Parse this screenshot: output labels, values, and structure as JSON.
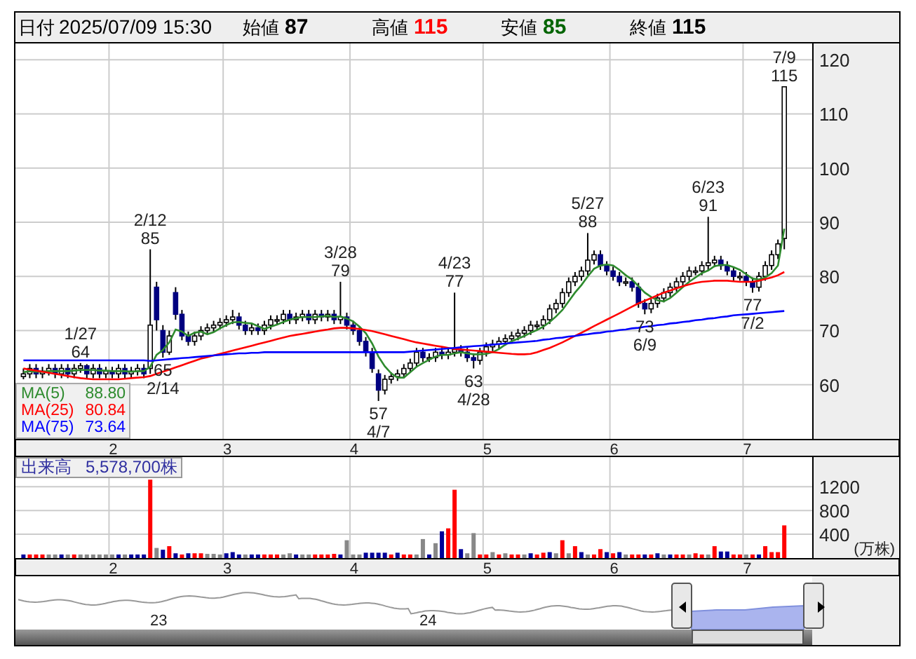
{
  "header": {
    "date_label": "日付",
    "date": "2025/07/09 15:30",
    "fields": [
      {
        "label": "始値",
        "value": "87",
        "color": "#000000"
      },
      {
        "label": "高値",
        "value": "115",
        "color": "#ff0000"
      },
      {
        "label": "安値",
        "value": "85",
        "color": "#006400"
      },
      {
        "label": "終値",
        "value": "115",
        "color": "#000000"
      }
    ]
  },
  "price": {
    "chart_data": {
      "type": "candlestick",
      "ylim": [
        50,
        123
      ],
      "yticks": [
        60,
        70,
        80,
        90,
        100,
        110,
        120
      ],
      "categories": [
        null,
        null,
        null,
        null,
        null,
        null,
        null,
        null,
        null,
        null,
        null,
        null,
        null,
        null,
        "2",
        null,
        null,
        null,
        null,
        null,
        null,
        null,
        null,
        null,
        null,
        null,
        null,
        null,
        null,
        null,
        null,
        null,
        "3",
        null,
        null,
        null,
        null,
        null,
        null,
        null,
        null,
        null,
        null,
        null,
        null,
        null,
        null,
        null,
        null,
        null,
        null,
        null,
        "4",
        null,
        null,
        null,
        null,
        null,
        null,
        null,
        null,
        null,
        null,
        null,
        null,
        null,
        null,
        null,
        null,
        null,
        null,
        null,
        null,
        "5",
        null,
        null,
        null,
        null,
        null,
        null,
        null,
        null,
        null,
        null,
        null,
        null,
        null,
        null,
        null,
        null,
        null,
        null,
        null,
        "6",
        null,
        null,
        null,
        null,
        null,
        null,
        null,
        null,
        null,
        null,
        null,
        null,
        null,
        null,
        null,
        null,
        null,
        null,
        null,
        null,
        "7",
        null,
        null,
        null,
        null,
        null,
        null
      ],
      "grid": true,
      "ohlc": [
        [
          61.5,
          63,
          61,
          62
        ],
        [
          62,
          63.8,
          61.2,
          63
        ],
        [
          63,
          63.8,
          61.2,
          62
        ],
        [
          62,
          63.3,
          61.2,
          62.5
        ],
        [
          62.5,
          63.8,
          61.7,
          63
        ],
        [
          63,
          63.8,
          61.2,
          62
        ],
        [
          62,
          63.8,
          61.2,
          63
        ],
        [
          63,
          63.8,
          61.2,
          62
        ],
        [
          62,
          63.8,
          61.2,
          63
        ],
        [
          63,
          64,
          62.2,
          63.5
        ],
        [
          63.5,
          63.8,
          61.2,
          62
        ],
        [
          62,
          63.8,
          61.2,
          63
        ],
        [
          63,
          63.8,
          61.2,
          62
        ],
        [
          62,
          63.3,
          61.2,
          62.5
        ],
        [
          62.5,
          63.3,
          61.2,
          62
        ],
        [
          62,
          63.8,
          61.2,
          63
        ],
        [
          63,
          63.8,
          61.2,
          62
        ],
        [
          62,
          63.3,
          61.2,
          62.5
        ],
        [
          62.5,
          63.8,
          61.7,
          63
        ],
        [
          63,
          63.8,
          61.2,
          62
        ],
        [
          63,
          85,
          62,
          71
        ],
        [
          78,
          79,
          70,
          72
        ],
        [
          70,
          71,
          65,
          66
        ],
        [
          66,
          70,
          65.5,
          69
        ],
        [
          77,
          78,
          72,
          73
        ],
        [
          73,
          73.8,
          68.2,
          69
        ],
        [
          69,
          69.8,
          67.2,
          68
        ],
        [
          68,
          69.8,
          67.2,
          69
        ],
        [
          69,
          70.8,
          68.2,
          70
        ],
        [
          70,
          71.3,
          69.2,
          70.5
        ],
        [
          70.5,
          71.8,
          69.7,
          71
        ],
        [
          71,
          72.3,
          70.2,
          71.5
        ],
        [
          71.5,
          72.8,
          70.7,
          72
        ],
        [
          72,
          73.8,
          71.2,
          72.5
        ],
        [
          72.5,
          73.3,
          70.2,
          71
        ],
        [
          71,
          71.8,
          69.2,
          70
        ],
        [
          70,
          71.3,
          69.2,
          70.5
        ],
        [
          70.5,
          71.3,
          69.2,
          70
        ],
        [
          70,
          71.8,
          69.2,
          71
        ],
        [
          71,
          72.8,
          70.2,
          72
        ],
        [
          72,
          72.8,
          71.2,
          72
        ],
        [
          72,
          73.8,
          71.2,
          73
        ],
        [
          73,
          73.8,
          71.2,
          72
        ],
        [
          72,
          73.3,
          71.2,
          72.5
        ],
        [
          72.5,
          73.8,
          71.7,
          73
        ],
        [
          73,
          73.8,
          71.2,
          72
        ],
        [
          72,
          73.8,
          71.2,
          73
        ],
        [
          73,
          73.8,
          71.7,
          72.5
        ],
        [
          72.5,
          73.8,
          71.7,
          73
        ],
        [
          73,
          73.8,
          71.2,
          72
        ],
        [
          72,
          79,
          71.2,
          72.5
        ],
        [
          72.5,
          73.3,
          70.2,
          71
        ],
        [
          71,
          71.8,
          69.2,
          70
        ],
        [
          70,
          70.8,
          67.2,
          68
        ],
        [
          68,
          68.8,
          65.2,
          66
        ],
        [
          66,
          66.8,
          62.2,
          63
        ],
        [
          62,
          62.8,
          57,
          59
        ],
        [
          59,
          61.8,
          58.2,
          61
        ],
        [
          61,
          62.3,
          60.2,
          61.5
        ],
        [
          61.5,
          62.8,
          60.7,
          62
        ],
        [
          62,
          63.8,
          61.2,
          63
        ],
        [
          63,
          64.8,
          62.2,
          64
        ],
        [
          64,
          66.8,
          63.2,
          66
        ],
        [
          66,
          66.8,
          64.2,
          65
        ],
        [
          65,
          65.8,
          64.2,
          65
        ],
        [
          65,
          66.8,
          64.2,
          66
        ],
        [
          66,
          66.8,
          64.7,
          65.5
        ],
        [
          65.5,
          66.8,
          64.7,
          66
        ],
        [
          66,
          77,
          65.2,
          66.5
        ],
        [
          66.5,
          67.3,
          65.2,
          66
        ],
        [
          66,
          66.8,
          64.2,
          65
        ],
        [
          65,
          65.8,
          63,
          64.5
        ],
        [
          64.5,
          66.8,
          63.7,
          66
        ],
        [
          66,
          67.8,
          65.2,
          67
        ],
        [
          67,
          68.3,
          66.2,
          67.5
        ],
        [
          67.5,
          68.8,
          66.7,
          68
        ],
        [
          68,
          69.3,
          67.2,
          68.5
        ],
        [
          68.5,
          69.8,
          67.7,
          69
        ],
        [
          69,
          70.3,
          68.2,
          69.5
        ],
        [
          69.5,
          70.8,
          68.7,
          70
        ],
        [
          70,
          71.8,
          69.2,
          71
        ],
        [
          71,
          71.8,
          70.2,
          71
        ],
        [
          71,
          72.8,
          70.2,
          72
        ],
        [
          72,
          74.8,
          71.2,
          74
        ],
        [
          74,
          75.8,
          73.2,
          75
        ],
        [
          75,
          77.8,
          74.2,
          77
        ],
        [
          77,
          79.8,
          76.2,
          79
        ],
        [
          79,
          80.8,
          78.2,
          80
        ],
        [
          80,
          81.8,
          79.2,
          81
        ],
        [
          81,
          88,
          80.2,
          83
        ],
        [
          83,
          84.8,
          82.2,
          84
        ],
        [
          84,
          84.8,
          81.2,
          82
        ],
        [
          82,
          82.8,
          80.2,
          81
        ],
        [
          81,
          81.8,
          79.2,
          80
        ],
        [
          80,
          80.8,
          78.2,
          79
        ],
        [
          79,
          79.8,
          78.2,
          79
        ],
        [
          79,
          79.8,
          77.2,
          78
        ],
        [
          78,
          78.8,
          74.2,
          75
        ],
        [
          75,
          75.8,
          73,
          74
        ],
        [
          74,
          75.8,
          73.2,
          75
        ],
        [
          75,
          76.8,
          74.2,
          76
        ],
        [
          76,
          77.8,
          75.2,
          77
        ],
        [
          77,
          78.8,
          76.2,
          78
        ],
        [
          78,
          79.8,
          77.2,
          79
        ],
        [
          79,
          80.8,
          78.2,
          80
        ],
        [
          80,
          81.8,
          79.2,
          81
        ],
        [
          81,
          81.8,
          80.2,
          81
        ],
        [
          81,
          82.8,
          80.2,
          82
        ],
        [
          82,
          91,
          81.2,
          82.5
        ],
        [
          82.5,
          83.8,
          81.7,
          83
        ],
        [
          83,
          83.8,
          81.2,
          82
        ],
        [
          82,
          82.8,
          80.2,
          81
        ],
        [
          81,
          81.8,
          79.2,
          80
        ],
        [
          80,
          80.8,
          79.2,
          80
        ],
        [
          80,
          80.8,
          78.2,
          79
        ],
        [
          79,
          79.8,
          77,
          78
        ],
        [
          78,
          80.8,
          77.2,
          80
        ],
        [
          80,
          82.8,
          79.2,
          82
        ],
        [
          82,
          84.8,
          81.2,
          84
        ],
        [
          84,
          86.8,
          83.2,
          86
        ],
        [
          87,
          115,
          85,
          115
        ]
      ],
      "series": [
        {
          "name": "MA(5)",
          "type": "line",
          "color": "#2e8b2e",
          "values": [
            62.3,
            62.5,
            62.4,
            62.4,
            62.5,
            62.5,
            62.5,
            62.5,
            62.6,
            62.7,
            62.7,
            62.7,
            62.6,
            62.6,
            62.5,
            62.5,
            62.5,
            62.4,
            62.5,
            62.5,
            63.3,
            65.5,
            66.4,
            67.8,
            70.2,
            69.8,
            69,
            69.6,
            69.8,
            69.3,
            69.7,
            70.4,
            71,
            71.5,
            71.6,
            71.4,
            71.3,
            70.8,
            70.3,
            70.7,
            71.1,
            71.6,
            72,
            72.3,
            72.5,
            72.5,
            72.5,
            72.6,
            72.7,
            72.5,
            72.6,
            72.2,
            71.7,
            70.7,
            69.5,
            67.6,
            65.2,
            63.4,
            62.1,
            61.3,
            61.3,
            62.3,
            63.3,
            64,
            64.6,
            65.2,
            65.5,
            65.5,
            65.8,
            66,
            65.8,
            65.6,
            65.6,
            65.7,
            66,
            66.6,
            67.4,
            68,
            68.5,
            69,
            69.6,
            70.1,
            70.7,
            71.6,
            72.6,
            73.8,
            75.4,
            77,
            78.4,
            80,
            81.4,
            82,
            82.2,
            82,
            81.2,
            80.2,
            79.4,
            78.2,
            77,
            76.2,
            75.6,
            75.4,
            76,
            77,
            78,
            79,
            79.8,
            80.6,
            81.1,
            81.9,
            82.1,
            82.1,
            81.7,
            81.2,
            80.4,
            79.6,
            79.4,
            79.8,
            80.6,
            82,
            88.8
          ]
        },
        {
          "name": "MA(25)",
          "type": "line",
          "color": "#ff0000",
          "values": [
            63,
            62.8,
            62.6,
            62.4,
            62.2,
            62,
            61.8,
            61.6,
            61.4,
            61.2,
            61.1,
            61,
            61,
            61,
            61,
            61,
            61.1,
            61.2,
            61.3,
            61.4,
            61.6,
            62,
            62.4,
            62.8,
            63.2,
            63.6,
            64,
            64.4,
            64.8,
            65.1,
            65.4,
            65.7,
            66,
            66.3,
            66.6,
            66.9,
            67.2,
            67.5,
            67.8,
            68.1,
            68.4,
            68.7,
            69,
            69.2,
            69.4,
            69.6,
            69.8,
            70,
            70.2,
            70.4,
            70.5,
            70.5,
            70.4,
            70.3,
            70.1,
            69.9,
            69.6,
            69.3,
            69,
            68.7,
            68.4,
            68.1,
            67.8,
            67.6,
            67.4,
            67.2,
            67,
            66.8,
            66.6,
            66.5,
            66.4,
            66.3,
            66.2,
            66.1,
            66,
            65.9,
            65.8,
            65.7,
            65.6,
            65.6,
            65.7,
            66,
            66.4,
            66.8,
            67.3,
            67.8,
            68.4,
            69,
            69.6,
            70.2,
            70.8,
            71.4,
            72,
            72.6,
            73.2,
            73.8,
            74.4,
            75,
            75.5,
            76,
            76.5,
            77,
            77.4,
            77.8,
            78.2,
            78.5,
            78.8,
            79,
            79.1,
            79.2,
            79.2,
            79.2,
            79.1,
            79,
            79,
            79,
            79.2,
            79.5,
            79.8,
            80.2,
            80.8
          ]
        },
        {
          "name": "MA(75)",
          "type": "line",
          "color": "#0000ff",
          "values": [
            64.5,
            64.5,
            64.5,
            64.5,
            64.5,
            64.5,
            64.5,
            64.5,
            64.5,
            64.5,
            64.5,
            64.5,
            64.5,
            64.5,
            64.5,
            64.5,
            64.5,
            64.5,
            64.5,
            64.5,
            64.4,
            64.5,
            64.6,
            64.7,
            64.8,
            64.9,
            65,
            65.1,
            65.2,
            65.3,
            65.4,
            65.5,
            65.6,
            65.7,
            65.8,
            65.8,
            65.9,
            65.9,
            66,
            66,
            66,
            66,
            66,
            66,
            66,
            66,
            66,
            66,
            66,
            66,
            66,
            66,
            66,
            66,
            66,
            66,
            66,
            66,
            66,
            66,
            66,
            66.1,
            66.2,
            66.3,
            66.4,
            66.5,
            66.6,
            66.7,
            66.8,
            66.9,
            67,
            67.1,
            67.2,
            67.3,
            67.4,
            67.5,
            67.6,
            67.7,
            67.8,
            67.9,
            68,
            68.1,
            68.3,
            68.4,
            68.6,
            68.7,
            68.9,
            69,
            69.2,
            69.3,
            69.5,
            69.6,
            69.8,
            69.9,
            70.1,
            70.2,
            70.4,
            70.5,
            70.7,
            70.8,
            71,
            71.1,
            71.3,
            71.4,
            71.6,
            71.7,
            71.9,
            72,
            72.2,
            72.3,
            72.5,
            72.6,
            72.8,
            72.9,
            73,
            73.1,
            73.2,
            73.3,
            73.4,
            73.5,
            73.6
          ]
        }
      ],
      "annotations": [
        {
          "y": 64,
          "text": "1/27\n64"
        },
        {
          "y": 85,
          "text": "2/12\n85"
        },
        {
          "y": 65,
          "text": "65\n2/14"
        },
        {
          "y": 79,
          "text": "3/28\n79"
        },
        {
          "y": 57,
          "text": "57\n4/7"
        },
        {
          "y": 77,
          "text": "4/23\n77"
        },
        {
          "y": 63,
          "text": "63\n4/28"
        },
        {
          "y": 88,
          "text": "5/27\n88"
        },
        {
          "y": 73,
          "text": "73\n6/9"
        },
        {
          "y": 91,
          "text": "6/23\n91"
        },
        {
          "y": 77,
          "text": "77\n7/2"
        },
        {
          "y": 115,
          "text": "7/9\n115"
        }
      ]
    },
    "legend_values": [
      "88.80",
      "80.84",
      "73.64"
    ]
  },
  "volume": {
    "label": "出来高",
    "value": "5,578,700株",
    "unit": "(万株)",
    "chart_data": {
      "type": "bar",
      "grid": true,
      "ylim": [
        0,
        1700
      ],
      "yticks": [
        400,
        800,
        1200
      ],
      "categories": [
        null,
        null,
        null,
        null,
        null,
        null,
        null,
        null,
        null,
        null,
        null,
        null,
        null,
        null,
        "2",
        null,
        null,
        null,
        null,
        null,
        null,
        null,
        null,
        null,
        null,
        null,
        null,
        null,
        null,
        null,
        null,
        null,
        "3",
        null,
        null,
        null,
        null,
        null,
        null,
        null,
        null,
        null,
        null,
        null,
        null,
        null,
        null,
        null,
        null,
        null,
        null,
        null,
        "4",
        null,
        null,
        null,
        null,
        null,
        null,
        null,
        null,
        null,
        null,
        null,
        null,
        null,
        null,
        null,
        null,
        null,
        null,
        null,
        null,
        "5",
        null,
        null,
        null,
        null,
        null,
        null,
        null,
        null,
        null,
        null,
        null,
        null,
        null,
        null,
        null,
        null,
        null,
        null,
        null,
        "6",
        null,
        null,
        null,
        null,
        null,
        null,
        null,
        null,
        null,
        null,
        null,
        null,
        null,
        null,
        null,
        null,
        null,
        null,
        null,
        null,
        "7",
        null,
        null,
        null,
        null,
        null,
        null
      ],
      "series": [
        {
          "color": "#ff0000",
          "values": [
            null,
            60,
            60,
            60,
            null,
            null,
            null,
            null,
            60,
            null,
            null,
            null,
            null,
            null,
            null,
            null,
            null,
            null,
            null,
            null,
            1320,
            null,
            null,
            200,
            null,
            60,
            null,
            80,
            80,
            null,
            null,
            null,
            null,
            null,
            null,
            null,
            null,
            null,
            60,
            60,
            60,
            null,
            null,
            null,
            null,
            null,
            60,
            60,
            60,
            70,
            null,
            null,
            null,
            null,
            null,
            null,
            null,
            null,
            60,
            null,
            60,
            60,
            null,
            null,
            null,
            null,
            null,
            500,
            1150,
            null,
            null,
            null,
            60,
            60,
            null,
            60,
            null,
            60,
            60,
            null,
            null,
            60,
            90,
            null,
            null,
            300,
            null,
            200,
            null,
            null,
            60,
            150,
            null,
            80,
            null,
            null,
            60,
            60,
            null,
            60,
            null,
            null,
            null,
            60,
            60,
            null,
            80,
            60,
            null,
            200,
            null,
            null,
            60,
            60,
            null,
            60,
            null,
            200,
            100,
            100,
            550
          ]
        },
        {
          "color": "#000099",
          "values": [
            60,
            null,
            null,
            null,
            null,
            null,
            60,
            null,
            null,
            null,
            null,
            null,
            null,
            null,
            null,
            60,
            null,
            60,
            60,
            60,
            null,
            null,
            140,
            null,
            80,
            null,
            80,
            null,
            null,
            null,
            null,
            null,
            80,
            100,
            60,
            null,
            60,
            60,
            null,
            null,
            null,
            null,
            null,
            60,
            null,
            null,
            null,
            null,
            null,
            null,
            60,
            null,
            null,
            null,
            90,
            90,
            90,
            90,
            null,
            90,
            null,
            null,
            null,
            null,
            60,
            null,
            450,
            null,
            null,
            150,
            null,
            null,
            null,
            null,
            null,
            null,
            null,
            null,
            null,
            null,
            80,
            null,
            null,
            100,
            null,
            null,
            null,
            null,
            100,
            null,
            null,
            null,
            100,
            null,
            100,
            null,
            null,
            null,
            60,
            null,
            80,
            null,
            60,
            null,
            null,
            null,
            null,
            null,
            null,
            null,
            110,
            110,
            null,
            null,
            null,
            null,
            60,
            null,
            null,
            null,
            null
          ]
        },
        {
          "color": "#888888",
          "values": [
            null,
            null,
            null,
            null,
            60,
            60,
            null,
            60,
            null,
            60,
            60,
            60,
            60,
            60,
            60,
            null,
            60,
            null,
            null,
            null,
            null,
            170,
            null,
            null,
            null,
            null,
            null,
            null,
            null,
            70,
            70,
            60,
            null,
            null,
            null,
            60,
            null,
            null,
            null,
            null,
            null,
            60,
            80,
            null,
            60,
            60,
            null,
            null,
            null,
            null,
            null,
            300,
            60,
            60,
            null,
            null,
            null,
            null,
            null,
            null,
            null,
            null,
            60,
            320,
            null,
            250,
            null,
            null,
            null,
            null,
            80,
            420,
            null,
            null,
            100,
            null,
            80,
            null,
            null,
            60,
            null,
            null,
            null,
            null,
            80,
            null,
            80,
            null,
            null,
            60,
            null,
            null,
            null,
            null,
            null,
            60,
            null,
            null,
            null,
            null,
            null,
            60,
            null,
            null,
            null,
            60,
            null,
            null,
            60,
            null,
            null,
            null,
            null,
            null,
            60,
            null,
            null,
            null,
            null,
            null,
            null
          ]
        }
      ]
    }
  },
  "navigator": {
    "labels": [
      "23",
      "24"
    ]
  }
}
